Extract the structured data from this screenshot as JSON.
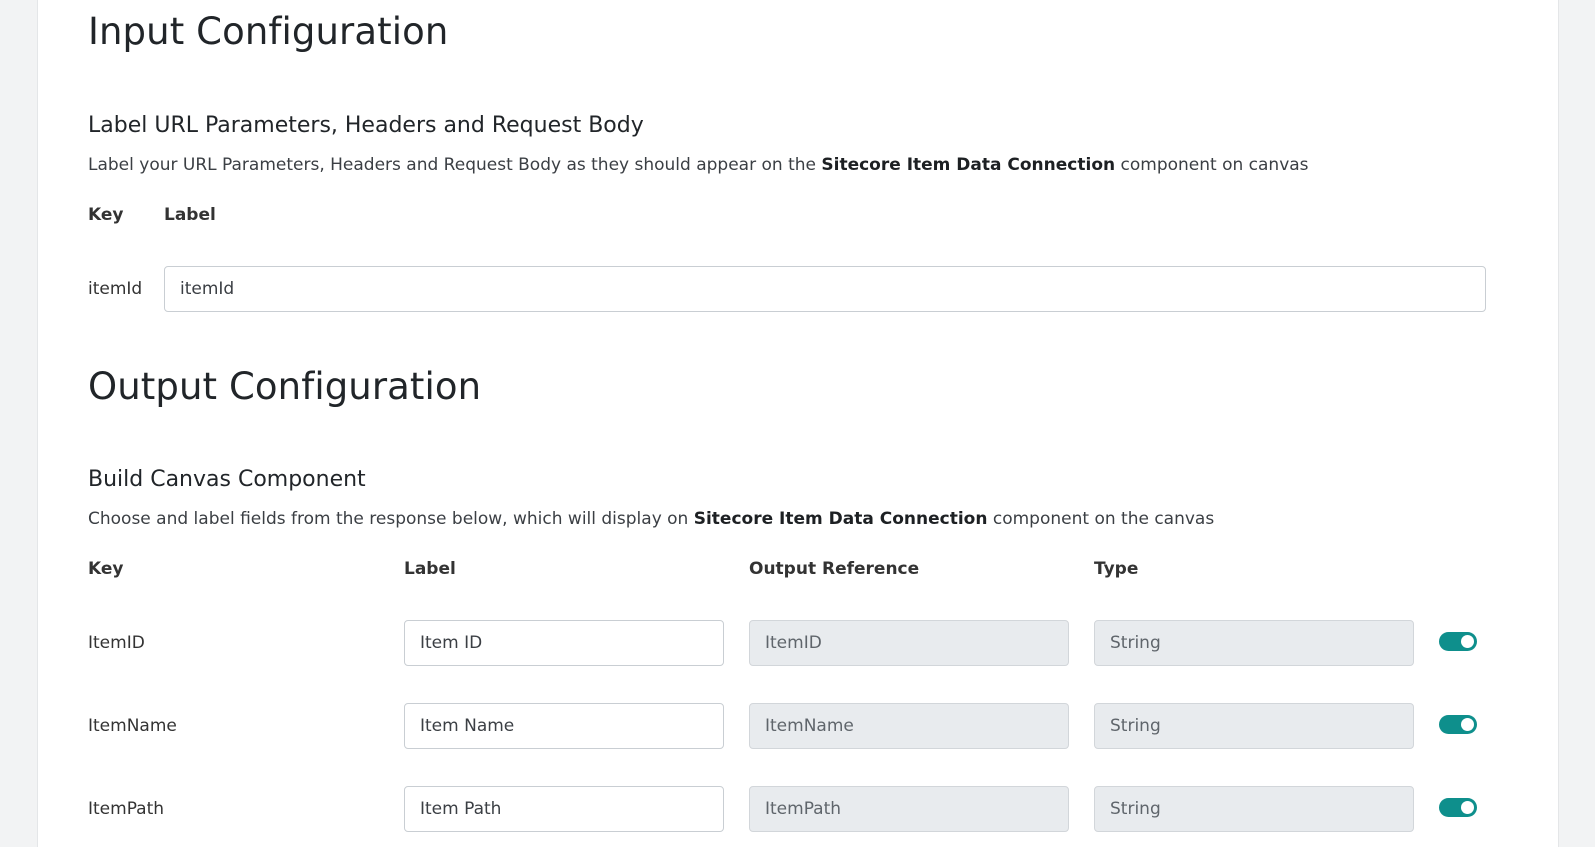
{
  "input_config": {
    "title": "Input Configuration",
    "section_title": "Label URL Parameters, Headers and Request Body",
    "description_prefix": "Label your URL Parameters, Headers and Request Body as they should appear on the ",
    "description_bold": "Sitecore Item Data Connection",
    "description_suffix": " component on canvas",
    "col_key": "Key",
    "col_label": "Label",
    "rows": [
      {
        "key": "itemId",
        "label_value": "itemId"
      }
    ]
  },
  "output_config": {
    "title": "Output Configuration",
    "section_title": "Build Canvas Component",
    "description_prefix": "Choose and label fields from the response below, which will display on ",
    "description_bold": "Sitecore Item Data Connection",
    "description_suffix": " component on the canvas",
    "col_key": "Key",
    "col_label": "Label",
    "col_output_reference": "Output Reference",
    "col_type": "Type",
    "rows": [
      {
        "key": "ItemID",
        "label_value": "Item ID",
        "output_reference": "ItemID",
        "type": "String",
        "enabled": true
      },
      {
        "key": "ItemName",
        "label_value": "Item Name",
        "output_reference": "ItemName",
        "type": "String",
        "enabled": true
      },
      {
        "key": "ItemPath",
        "label_value": "Item Path",
        "output_reference": "ItemPath",
        "type": "String",
        "enabled": true
      }
    ]
  },
  "colors": {
    "toggle_on": "#0e8f8c",
    "readonly_bg": "#e8ebee"
  }
}
